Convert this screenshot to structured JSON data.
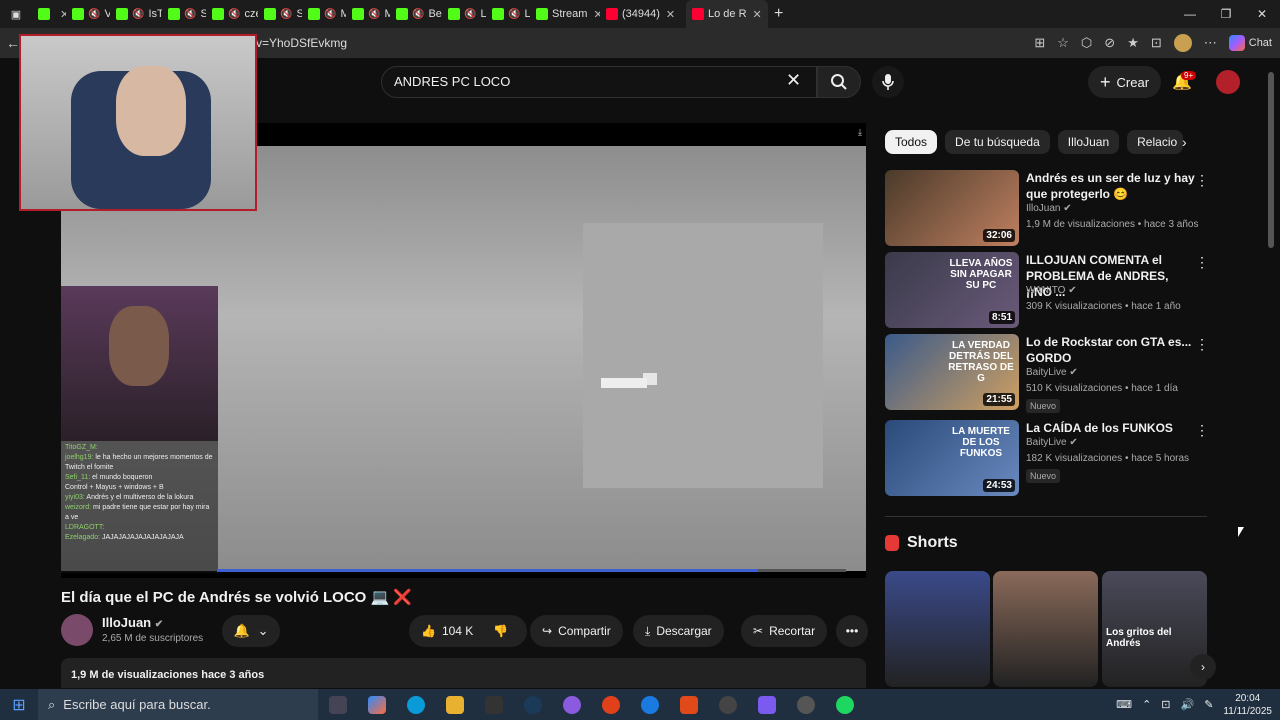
{
  "tabs": [
    {
      "label": "",
      "color": "#53fc18"
    },
    {
      "label": "Ve",
      "color": "#53fc18"
    },
    {
      "label": "IsTinch",
      "color": "#53fc18"
    },
    {
      "label": "Sta",
      "color": "#53fc18"
    },
    {
      "label": "czerito",
      "color": "#53fc18"
    },
    {
      "label": "Sic",
      "color": "#53fc18"
    },
    {
      "label": "Ma",
      "color": "#53fc18"
    },
    {
      "label": "Me",
      "color": "#53fc18"
    },
    {
      "label": "Bet_mi",
      "color": "#53fc18"
    },
    {
      "label": "Lio",
      "color": "#53fc18"
    },
    {
      "label": "Lio",
      "color": "#53fc18"
    },
    {
      "label": "Stream",
      "color": "#53fc18"
    },
    {
      "label": "(34944)",
      "color": "#ff0033"
    },
    {
      "label": "Lo de R",
      "color": "#ff0033"
    }
  ],
  "address": {
    "url": "v=YhoDSfEvkmg",
    "chat_label": "Chat"
  },
  "search": {
    "query": "ANDRES PC LOCO"
  },
  "header": {
    "create_label": "Crear",
    "notif_count": "9+"
  },
  "stream_chat": [
    {
      "user": "TitoGZ_M:",
      "msg": ""
    },
    {
      "user": "joelhg19:",
      "msg": "le ha hecho un mejores momentos de Twitch el fomite"
    },
    {
      "user": "Sefi_11:",
      "msg": "el mundo boqueron"
    },
    {
      "user": "",
      "msg": "Control + Mayus + windows + B"
    },
    {
      "user": "yiyi03:",
      "msg": "Andrés y el multiverso de la lokura"
    },
    {
      "user": "weizord:",
      "msg": "mi padre tiene que estar por hay mira a ve"
    },
    {
      "user": "LDRAGOTT:",
      "msg": ""
    },
    {
      "user": "Ezelagado:",
      "msg": "JAJAJAJAJAJAJAJAJAJA"
    }
  ],
  "video": {
    "title": "El día que el PC de Andrés se volvió LOCO 💻",
    "title_x": "❌",
    "channel": "IlloJuan",
    "subscribers": "2,65 M de suscriptores",
    "likes": "104 K",
    "share_label": "Compartir",
    "download_label": "Descargar",
    "clip_label": "Recortar",
    "views_line": "1,9 M de visualizaciones  hace 3 años",
    "progress": 0.86
  },
  "chips": [
    "Todos",
    "De tu búsqueda",
    "IlloJuan",
    "Relacio"
  ],
  "related": [
    {
      "title": "Andrés es un ser de luz y hay que protegerlo 😊",
      "channel": "IlloJuan",
      "meta": "1,9 M de visualizaciones • hace 3 años",
      "duration": "32:06",
      "new": "",
      "colors": [
        "#4a3a2a",
        "#c08060"
      ]
    },
    {
      "title": "ILLOJUAN COMENTA el PROBLEMA de ANDRES, ¡¡NO ...",
      "channel": "WANITO",
      "meta": "309 K visualizaciones • hace 1 año",
      "duration": "8:51",
      "new": "",
      "colors": [
        "#3a3a4a",
        "#6a5a7a"
      ],
      "overlay": "LLEVA AÑOS SIN APAGAR SU PC"
    },
    {
      "title": "Lo de Rockstar con GTA es... GORDO",
      "channel": "BaityLive",
      "meta": "510 K visualizaciones • hace 1 día",
      "duration": "21:55",
      "new": "Nuevo",
      "colors": [
        "#3a5a8a",
        "#d0a060"
      ],
      "overlay": "LA VERDAD DETRÁS DEL RETRASO DE G"
    },
    {
      "title": "La CAÍDA de los FUNKOS",
      "channel": "BaityLive",
      "meta": "182 K visualizaciones • hace 5 horas",
      "duration": "24:53",
      "new": "Nuevo",
      "colors": [
        "#2a4a7a",
        "#6a8ac0"
      ],
      "overlay": "LA MUERTE DE LOS FUNKOS"
    }
  ],
  "shorts": {
    "heading": "Shorts",
    "items": [
      {
        "caption": "",
        "color": "#3a4a8a"
      },
      {
        "caption": "",
        "color": "#8a6a5a"
      },
      {
        "caption": "Los gritos del Andrés",
        "color": "#4a4a5a"
      }
    ]
  },
  "taskbar": {
    "search_placeholder": "Escribe aquí para buscar.",
    "time": "20:04",
    "date": "11/11/2025"
  }
}
